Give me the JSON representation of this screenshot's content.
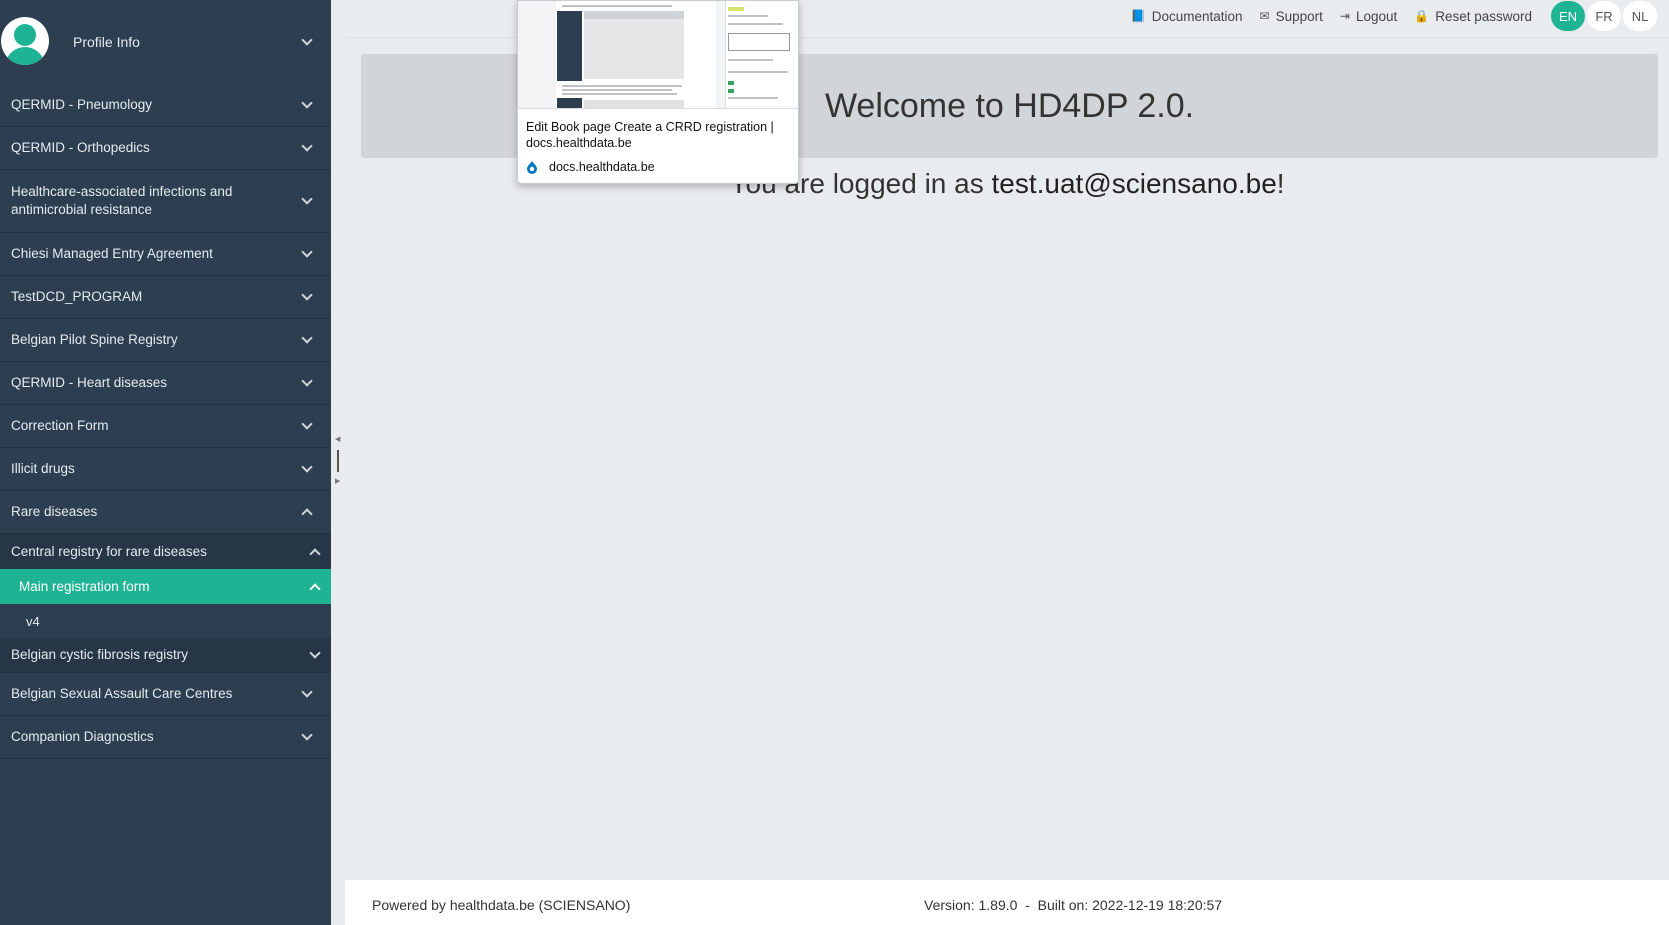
{
  "sidebar": {
    "profile_label": "Profile Info",
    "items": [
      {
        "label": "QERMID - Pneumology"
      },
      {
        "label": "QERMID - Orthopedics"
      },
      {
        "label": "Healthcare-associated infections and antimicrobial resistance"
      },
      {
        "label": "Chiesi Managed Entry Agreement"
      },
      {
        "label": "TestDCD_PROGRAM"
      },
      {
        "label": "Belgian Pilot Spine Registry"
      },
      {
        "label": "QERMID - Heart diseases"
      },
      {
        "label": "Correction Form"
      },
      {
        "label": "Illicit drugs"
      },
      {
        "label": "Rare diseases"
      }
    ],
    "rare_sub": {
      "registry": "Central registry for rare diseases",
      "form": "Main registration form",
      "version": "v4"
    },
    "items_after": [
      {
        "label": "Belgian cystic fibrosis registry"
      },
      {
        "label": "Belgian Sexual Assault Care Centres"
      },
      {
        "label": "Companion Diagnostics"
      }
    ]
  },
  "topbar": {
    "documentation": "Documentation",
    "support": "Support",
    "logout": "Logout",
    "reset_password": "Reset password",
    "languages": [
      "EN",
      "FR",
      "NL"
    ],
    "active_language": "EN"
  },
  "main": {
    "welcome": "Welcome to HD4DP 2.0.",
    "logged_prefix": "You are logged in as ",
    "email": "test.uat@sciensano.be",
    "logged_suffix": "!"
  },
  "popup": {
    "title": "Edit Book page Create a CRRD registration | docs.healthdata.be",
    "source": "docs.healthdata.be"
  },
  "footer": {
    "powered": "Powered by healthdata.be (SCIENSANO)",
    "version": "Version: 1.89.0  -  Built on: 2022-12-19 18:20:57"
  },
  "colors": {
    "sidebar_bg": "#2c3e50",
    "accent": "#1eb392",
    "page_bg": "#e9ecef"
  }
}
